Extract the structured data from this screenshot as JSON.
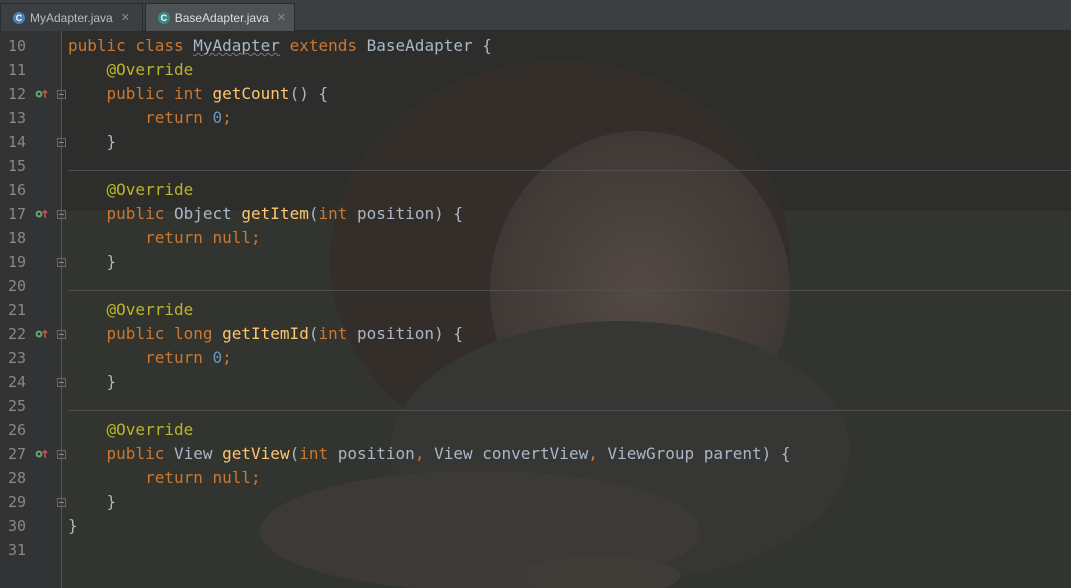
{
  "tabs": [
    {
      "label": "MyAdapter.java",
      "icon": "class-file-icon",
      "active": false
    },
    {
      "label": "BaseAdapter.java",
      "icon": "class-file-icon",
      "active": true
    }
  ],
  "colors": {
    "keyword": "#cc7832",
    "annotation": "#bbb529",
    "method": "#ffc66d",
    "number": "#6897bb",
    "text": "#a9b7c6",
    "line_number": "#888888",
    "background": "#2b2b2b"
  },
  "code_lines": [
    {
      "n": "10",
      "marker": false,
      "fold": false,
      "tokens": [
        [
          "kw",
          "public class "
        ],
        [
          "und",
          "MyAdapter"
        ],
        [
          "kw",
          " extends "
        ],
        [
          "plain",
          "BaseAdapter {"
        ]
      ]
    },
    {
      "n": "11",
      "marker": false,
      "fold": false,
      "tokens": [
        [
          "plain",
          "    "
        ],
        [
          "an",
          "@Override"
        ]
      ]
    },
    {
      "n": "12",
      "marker": true,
      "fold": true,
      "tokens": [
        [
          "plain",
          "    "
        ],
        [
          "kw",
          "public int "
        ],
        [
          "fn",
          "getCount"
        ],
        [
          "plain",
          "() {"
        ]
      ]
    },
    {
      "n": "13",
      "marker": false,
      "fold": false,
      "tokens": [
        [
          "plain",
          "        "
        ],
        [
          "kw",
          "return "
        ],
        [
          "num",
          "0"
        ],
        [
          "kw",
          ";"
        ]
      ]
    },
    {
      "n": "14",
      "marker": false,
      "fold": true,
      "tokens": [
        [
          "plain",
          "    }"
        ]
      ]
    },
    {
      "n": "15",
      "marker": false,
      "fold": false,
      "sep": true,
      "tokens": []
    },
    {
      "n": "16",
      "marker": false,
      "fold": false,
      "tokens": [
        [
          "plain",
          "    "
        ],
        [
          "an",
          "@Override"
        ]
      ]
    },
    {
      "n": "17",
      "marker": true,
      "fold": true,
      "tokens": [
        [
          "plain",
          "    "
        ],
        [
          "kw",
          "public "
        ],
        [
          "plain",
          "Object "
        ],
        [
          "fn",
          "getItem"
        ],
        [
          "plain",
          "("
        ],
        [
          "kw",
          "int "
        ],
        [
          "plain",
          "position) {"
        ]
      ]
    },
    {
      "n": "18",
      "marker": false,
      "fold": false,
      "tokens": [
        [
          "plain",
          "        "
        ],
        [
          "kw",
          "return null;"
        ]
      ]
    },
    {
      "n": "19",
      "marker": false,
      "fold": true,
      "tokens": [
        [
          "plain",
          "    }"
        ]
      ]
    },
    {
      "n": "20",
      "marker": false,
      "fold": false,
      "sep": true,
      "tokens": []
    },
    {
      "n": "21",
      "marker": false,
      "fold": false,
      "tokens": [
        [
          "plain",
          "    "
        ],
        [
          "an",
          "@Override"
        ]
      ]
    },
    {
      "n": "22",
      "marker": true,
      "fold": true,
      "tokens": [
        [
          "plain",
          "    "
        ],
        [
          "kw",
          "public long "
        ],
        [
          "fn",
          "getItemId"
        ],
        [
          "plain",
          "("
        ],
        [
          "kw",
          "int "
        ],
        [
          "plain",
          "position) {"
        ]
      ]
    },
    {
      "n": "23",
      "marker": false,
      "fold": false,
      "tokens": [
        [
          "plain",
          "        "
        ],
        [
          "kw",
          "return "
        ],
        [
          "num",
          "0"
        ],
        [
          "kw",
          ";"
        ]
      ]
    },
    {
      "n": "24",
      "marker": false,
      "fold": true,
      "tokens": [
        [
          "plain",
          "    }"
        ]
      ]
    },
    {
      "n": "25",
      "marker": false,
      "fold": false,
      "sep": true,
      "tokens": []
    },
    {
      "n": "26",
      "marker": false,
      "fold": false,
      "tokens": [
        [
          "plain",
          "    "
        ],
        [
          "an",
          "@Override"
        ]
      ]
    },
    {
      "n": "27",
      "marker": true,
      "fold": true,
      "tokens": [
        [
          "plain",
          "    "
        ],
        [
          "kw",
          "public "
        ],
        [
          "plain",
          "View "
        ],
        [
          "fn",
          "getView"
        ],
        [
          "plain",
          "("
        ],
        [
          "kw",
          "int "
        ],
        [
          "plain",
          "position"
        ],
        [
          "kw",
          ", "
        ],
        [
          "plain",
          "View convertView"
        ],
        [
          "kw",
          ", "
        ],
        [
          "plain",
          "ViewGroup parent) {"
        ]
      ]
    },
    {
      "n": "28",
      "marker": false,
      "fold": false,
      "tokens": [
        [
          "plain",
          "        "
        ],
        [
          "kw",
          "return null;"
        ]
      ]
    },
    {
      "n": "29",
      "marker": false,
      "fold": true,
      "tokens": [
        [
          "plain",
          "    }"
        ]
      ]
    },
    {
      "n": "30",
      "marker": false,
      "fold": false,
      "tokens": [
        [
          "plain",
          "}"
        ]
      ]
    },
    {
      "n": "31",
      "marker": false,
      "fold": false,
      "tokens": []
    }
  ]
}
